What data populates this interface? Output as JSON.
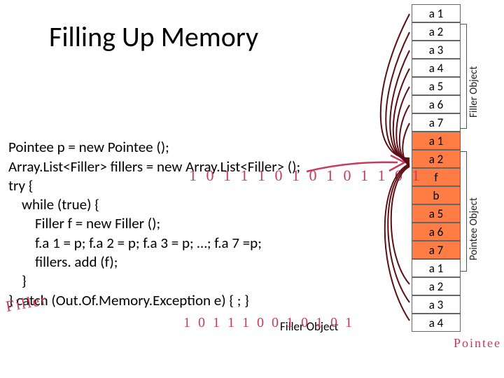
{
  "title": "Filling Up Memory",
  "code": {
    "l1": "Pointee p = new Pointee ();",
    "l2": "Array.List<Filler> fillers = new Array.List<Filler> ();",
    "l3": "try {",
    "l4": "    while (true) {",
    "l5": "        Filler f = new Filler ();",
    "l6": "        f.a 1 = p; f.a 2 = p; f.a 3 = p; …; f.a 7 =p;",
    "l7": "        fillers. add (f);",
    "l8": "    }",
    "l9": "} catch (Out.Of.Memory.Exception e) { ; }"
  },
  "memory": {
    "filler_block": [
      "a 1",
      "a 2",
      "a 3",
      "a 4",
      "a 5",
      "a 6",
      "a 7"
    ],
    "pointee_block": [
      "a 1",
      "a 2",
      "f",
      "b",
      "a 5",
      "a 6",
      "a 7"
    ],
    "next_block": [
      "a 1",
      "a 2",
      "a 3",
      "a 4"
    ]
  },
  "labels": {
    "filler_object": "Filler Object",
    "pointee_object": "Pointee Object",
    "filler_inline": "Filler Object"
  },
  "annotations": {
    "bits1": "1 0 1 1 1 0 1 0 1 0 1 1 0 1",
    "bits2": "1 0 1 1 1 0 0 1 0 1 0 1",
    "filler_word": "Filler",
    "pointee_word": "Pointee"
  },
  "colors": {
    "pointee_bg": "#ff7d45",
    "annotation": "#c83c5a",
    "curve": "#5b0f12"
  }
}
